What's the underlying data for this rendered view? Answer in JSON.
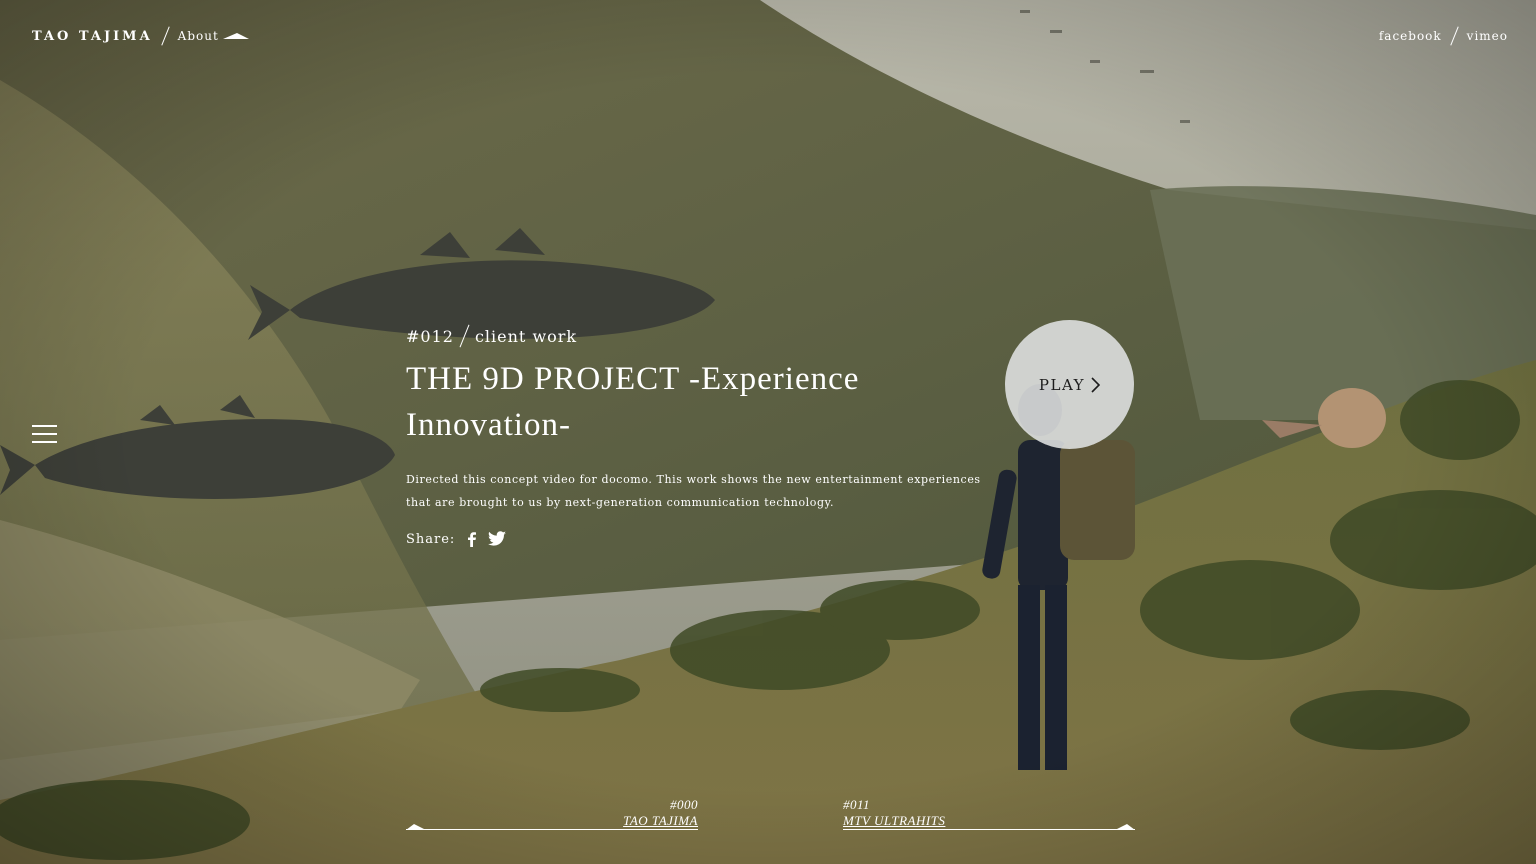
{
  "header": {
    "brand": "TAO TAJIMA",
    "about_label": "About",
    "social": [
      {
        "label": "facebook"
      },
      {
        "label": "vimeo"
      }
    ]
  },
  "project": {
    "number": "#012",
    "category": "client work",
    "title": "THE 9D PROJECT -Experience Innovation-",
    "description": "Directed this concept video for docomo. This work shows the new entertainment experiences that are brought to us by next-generation communication technology.",
    "share_label": "Share:"
  },
  "play_label": "PLAY",
  "pager": {
    "prev": {
      "number": "#000",
      "name": "TAO TAJIMA"
    },
    "next": {
      "number": "#011",
      "name": "MTV ULTRAHITS"
    }
  },
  "icons": {
    "menu": "hamburger-menu-icon",
    "facebook": "facebook-icon",
    "twitter": "twitter-icon",
    "play": "chevron-right-icon"
  }
}
